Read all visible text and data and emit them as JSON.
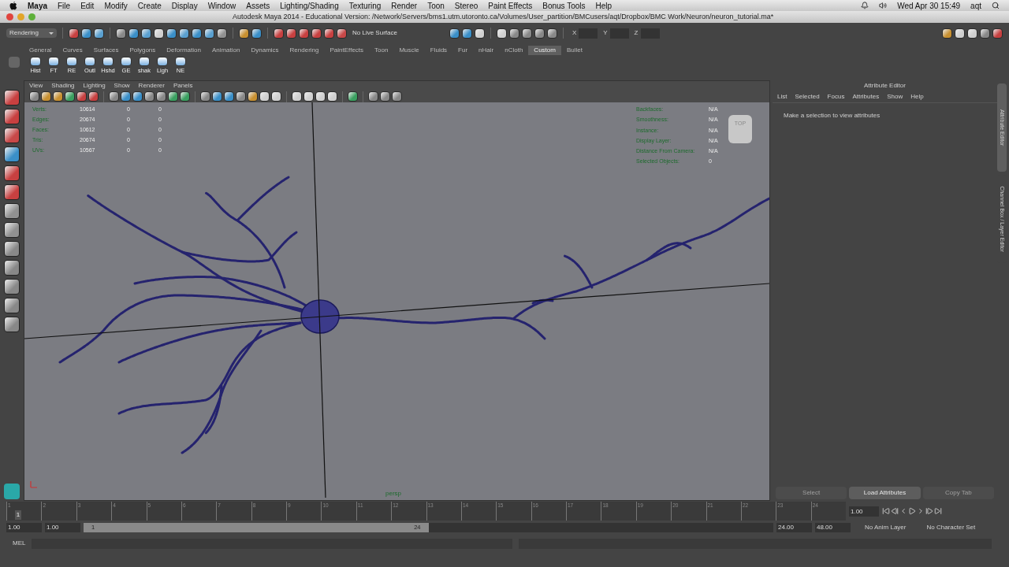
{
  "menubar": {
    "app": "Maya",
    "menus": [
      "File",
      "Edit",
      "Modify",
      "Create",
      "Display",
      "Window",
      "Assets",
      "Lighting/Shading",
      "Texturing",
      "Render",
      "Toon",
      "Stereo",
      "Paint Effects",
      "Bonus Tools",
      "Help"
    ],
    "clock": "Wed Apr 30  15:49",
    "user": "aqt"
  },
  "window": {
    "title": "Autodesk Maya 2014 - Educational Version: /Network/Servers/bms1.utm.utoronto.ca/Volumes/User_partition/BMCusers/aqt/Dropbox/BMC Work/Neuron/neuron_tutorial.ma*"
  },
  "status_line": {
    "menu_set": "Rendering",
    "live_surface": "No Live Surface",
    "fields": [
      "X",
      "Y",
      "Z"
    ]
  },
  "shelf": {
    "tabs": [
      {
        "label": "General",
        "selected": false
      },
      {
        "label": "Curves",
        "selected": false
      },
      {
        "label": "Surfaces",
        "selected": false
      },
      {
        "label": "Polygons",
        "selected": false
      },
      {
        "label": "Deformation",
        "selected": false
      },
      {
        "label": "Animation",
        "selected": false
      },
      {
        "label": "Dynamics",
        "selected": false
      },
      {
        "label": "Rendering",
        "selected": false
      },
      {
        "label": "PaintEffects",
        "selected": false
      },
      {
        "label": "Toon",
        "selected": false
      },
      {
        "label": "Muscle",
        "selected": false
      },
      {
        "label": "Fluids",
        "selected": false
      },
      {
        "label": "Fur",
        "selected": false
      },
      {
        "label": "nHair",
        "selected": false
      },
      {
        "label": "nCloth",
        "selected": false
      },
      {
        "label": "Custom",
        "selected": true
      },
      {
        "label": "Bullet",
        "selected": false
      }
    ],
    "buttons": [
      "Hist",
      "FT",
      "RE",
      "Outl",
      "Hshd",
      "GE",
      "shak",
      "Ligh",
      "NE"
    ]
  },
  "viewport": {
    "menus": [
      "View",
      "Shading",
      "Lighting",
      "Show",
      "Renderer",
      "Panels"
    ],
    "hud_left": [
      {
        "label": "Verts:",
        "values": [
          "10614",
          "0",
          "0"
        ]
      },
      {
        "label": "Edges:",
        "values": [
          "20674",
          "0",
          "0"
        ]
      },
      {
        "label": "Faces:",
        "values": [
          "10612",
          "0",
          "0"
        ]
      },
      {
        "label": "Tris:",
        "values": [
          "20674",
          "0",
          "0"
        ]
      },
      {
        "label": "UVs:",
        "values": [
          "10567",
          "0",
          "0"
        ]
      }
    ],
    "hud_right": [
      {
        "label": "Backfaces:",
        "value": "N/A"
      },
      {
        "label": "Smoothness:",
        "value": "N/A"
      },
      {
        "label": "Instance:",
        "value": "N/A"
      },
      {
        "label": "Display Layer:",
        "value": "N/A"
      },
      {
        "label": "Distance From Camera:",
        "value": "N/A"
      },
      {
        "label": "Selected Objects:",
        "value": "0"
      }
    ],
    "view_cube": "TOP",
    "camera": "persp"
  },
  "attribute_editor": {
    "title": "Attribute Editor",
    "menus": [
      "List",
      "Selected",
      "Focus",
      "Attributes",
      "Show",
      "Help"
    ],
    "message": "Make a selection to view attributes",
    "buttons": [
      {
        "label": "Select",
        "disabled": true
      },
      {
        "label": "Load Attributes",
        "disabled": false
      },
      {
        "label": "Copy Tab",
        "disabled": true
      }
    ]
  },
  "side_tabs": [
    {
      "label": "Attribute Editor",
      "selected": true
    },
    {
      "label": "Channel Box / Layer Editor",
      "selected": false
    }
  ],
  "timeline": {
    "ticks": [
      "1",
      "2",
      "3",
      "4",
      "5",
      "6",
      "7",
      "8",
      "9",
      "10",
      "11",
      "12",
      "13",
      "14",
      "15",
      "16",
      "17",
      "18",
      "19",
      "20",
      "21",
      "22",
      "23",
      "24"
    ],
    "current": "1",
    "level": 0.01,
    "current_frame": "1.00"
  },
  "range": {
    "start": "1.00",
    "playback_start": "1.00",
    "bar_start": "1",
    "bar_end": "24",
    "level": 0.5,
    "playback_end": "24.00",
    "end": "48.00",
    "anim_layer": "No Anim Layer",
    "character_set": "No Character Set"
  },
  "command_line": {
    "language": "MEL"
  }
}
